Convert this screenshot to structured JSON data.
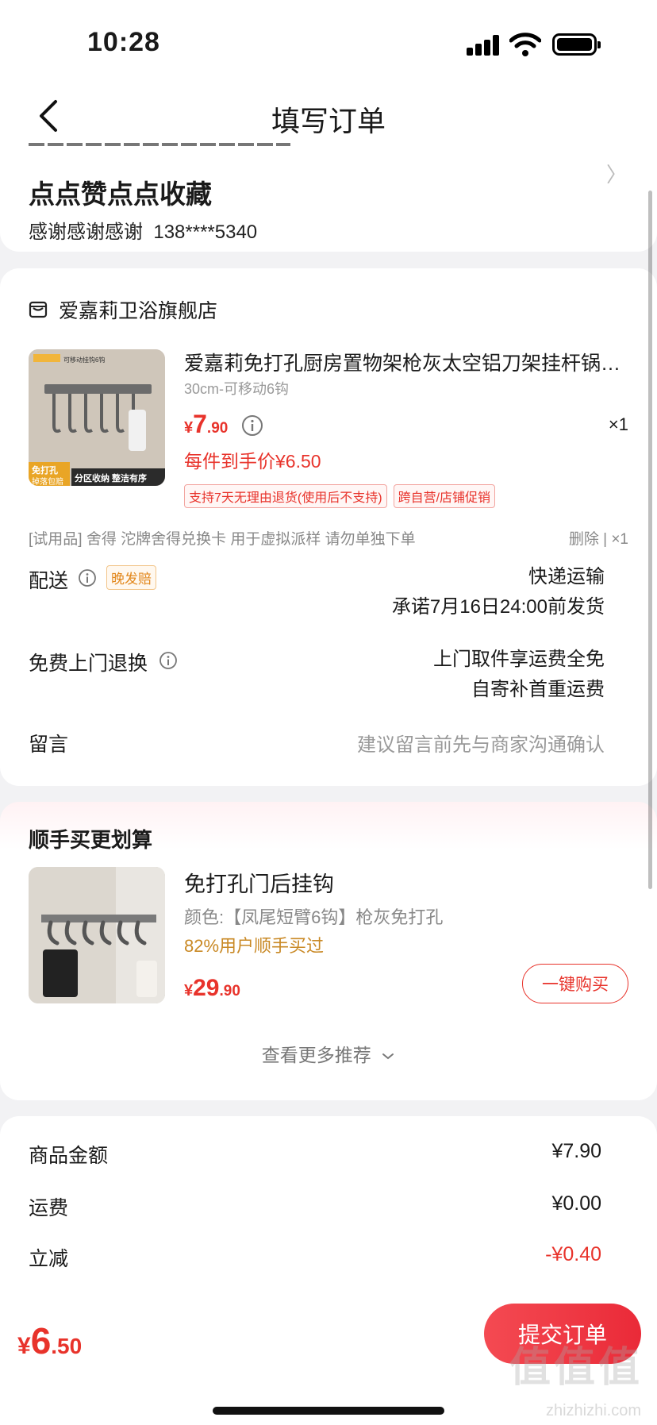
{
  "status_bar": {
    "time": "10:28"
  },
  "nav": {
    "title": "填写订单"
  },
  "address": {
    "name": "点点赞点点收藏",
    "contact": "感谢感谢感谢",
    "phone": "138****5340"
  },
  "order": {
    "store_name": "爱嘉莉卫浴旗舰店",
    "product": {
      "title": "爱嘉莉免打孔厨房置物架枪灰太空铝刀架挂杆锅…",
      "spec": "30cm-可移动6钩",
      "price_currency": "¥",
      "price_int": "7",
      "price_dec": ".90",
      "quantity": "×1",
      "after_price": "每件到手价¥6.50",
      "tags": [
        "支持7天无理由退货(使用后不支持)",
        "跨自营/店铺促销"
      ],
      "image_texts": {
        "badge1": "免打孔",
        "badge2": "掉落包赔",
        "banner": "分区收纳 整洁有序",
        "top": "可移动挂钩6钩"
      }
    },
    "trial_text": "[试用品] 舍得 沱牌舍得兑换卡 用于虚拟派样 请勿单独下单",
    "trial_actions": "删除 | ×1",
    "delivery": {
      "label": "配送",
      "badge": "晚发赔",
      "method": "快递运输",
      "promise": "承诺7月16日24:00前发货"
    },
    "free_return": {
      "label": "免费上门退换",
      "line1": "上门取件享运费全免",
      "line2": "自寄补首重运费"
    },
    "message": {
      "label": "留言",
      "placeholder": "建议留言前先与商家沟通确认"
    }
  },
  "recommend": {
    "title": "顺手买更划算",
    "item": {
      "name": "免打孔门后挂钩",
      "spec": "颜色:【凤尾短臂6钩】枪灰免打孔",
      "bought": "82%用户顺手买过",
      "price_currency": "¥",
      "price_int": "29",
      "price_dec": ".90",
      "buy_label": "一键购买"
    },
    "more_label": "查看更多推荐"
  },
  "summary": {
    "goods_label": "商品金额",
    "goods_value": "¥7.90",
    "shipping_label": "运费",
    "shipping_value": "¥0.00",
    "discount_label": "立减",
    "discount_value": "-¥0.40"
  },
  "bottom": {
    "total_currency": "¥",
    "total_int": "6",
    "total_dec": ".50",
    "submit_label": "提交订单"
  },
  "watermark": {
    "main": "值值值",
    "sub": "zhizhizhi.com"
  },
  "colors": {
    "accent": "#e8332b",
    "gold": "#c98925",
    "background": "#f2f2f4"
  }
}
